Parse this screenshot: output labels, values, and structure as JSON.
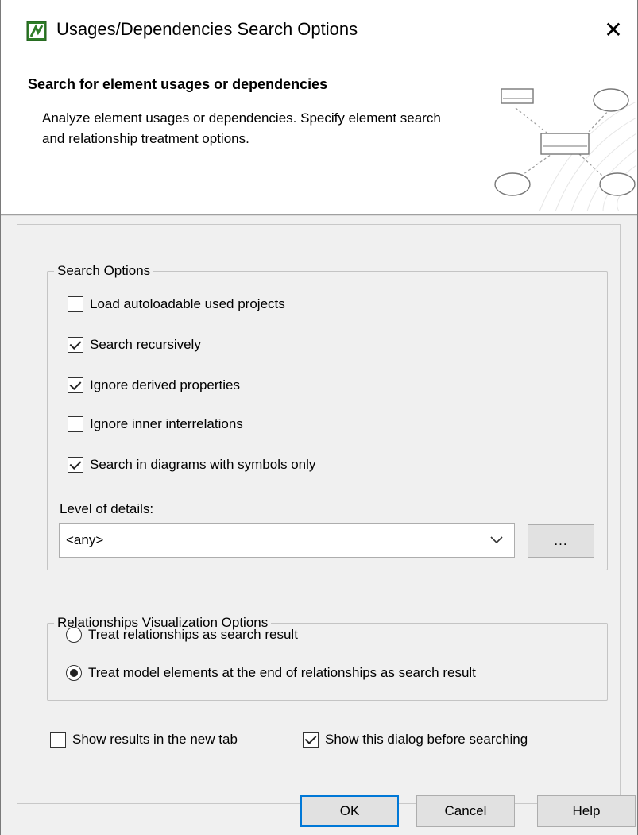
{
  "window": {
    "title": "Usages/Dependencies Search Options",
    "close_glyph": "✕",
    "app_icon": "magicdraw-app-icon"
  },
  "banner": {
    "title": "Search for element usages or dependencies",
    "description": "Analyze element usages or dependencies. Specify element search and relationship treatment options.",
    "graphic": "dependency-diagram-graphic"
  },
  "search_options": {
    "legend": "Search Options",
    "items": [
      {
        "label": "Load autoloadable used projects",
        "checked": false
      },
      {
        "label": "Search recursively",
        "checked": true
      },
      {
        "label": "Ignore derived properties",
        "checked": true
      },
      {
        "label": "Ignore inner interrelations",
        "checked": false
      },
      {
        "label": "Search in diagrams with symbols only",
        "checked": true
      }
    ],
    "level_label": "Level of details:",
    "level_value": "<any>",
    "more_button": "..."
  },
  "relationships": {
    "legend": "Relationships Visualization Options",
    "options": [
      {
        "label": "Treat relationships as search result",
        "selected": false
      },
      {
        "label": "Treat model elements at the end of relationships as search result",
        "selected": true
      }
    ]
  },
  "bottom_options": {
    "show_new_tab": {
      "label": "Show results in the new tab",
      "checked": false
    },
    "show_dialog": {
      "label": "Show this dialog before searching",
      "checked": true
    }
  },
  "buttons": {
    "ok": "OK",
    "cancel": "Cancel",
    "help": "Help"
  },
  "colors": {
    "default_button_border": "#0078d7",
    "app_icon_green": "#3f8f2f"
  }
}
